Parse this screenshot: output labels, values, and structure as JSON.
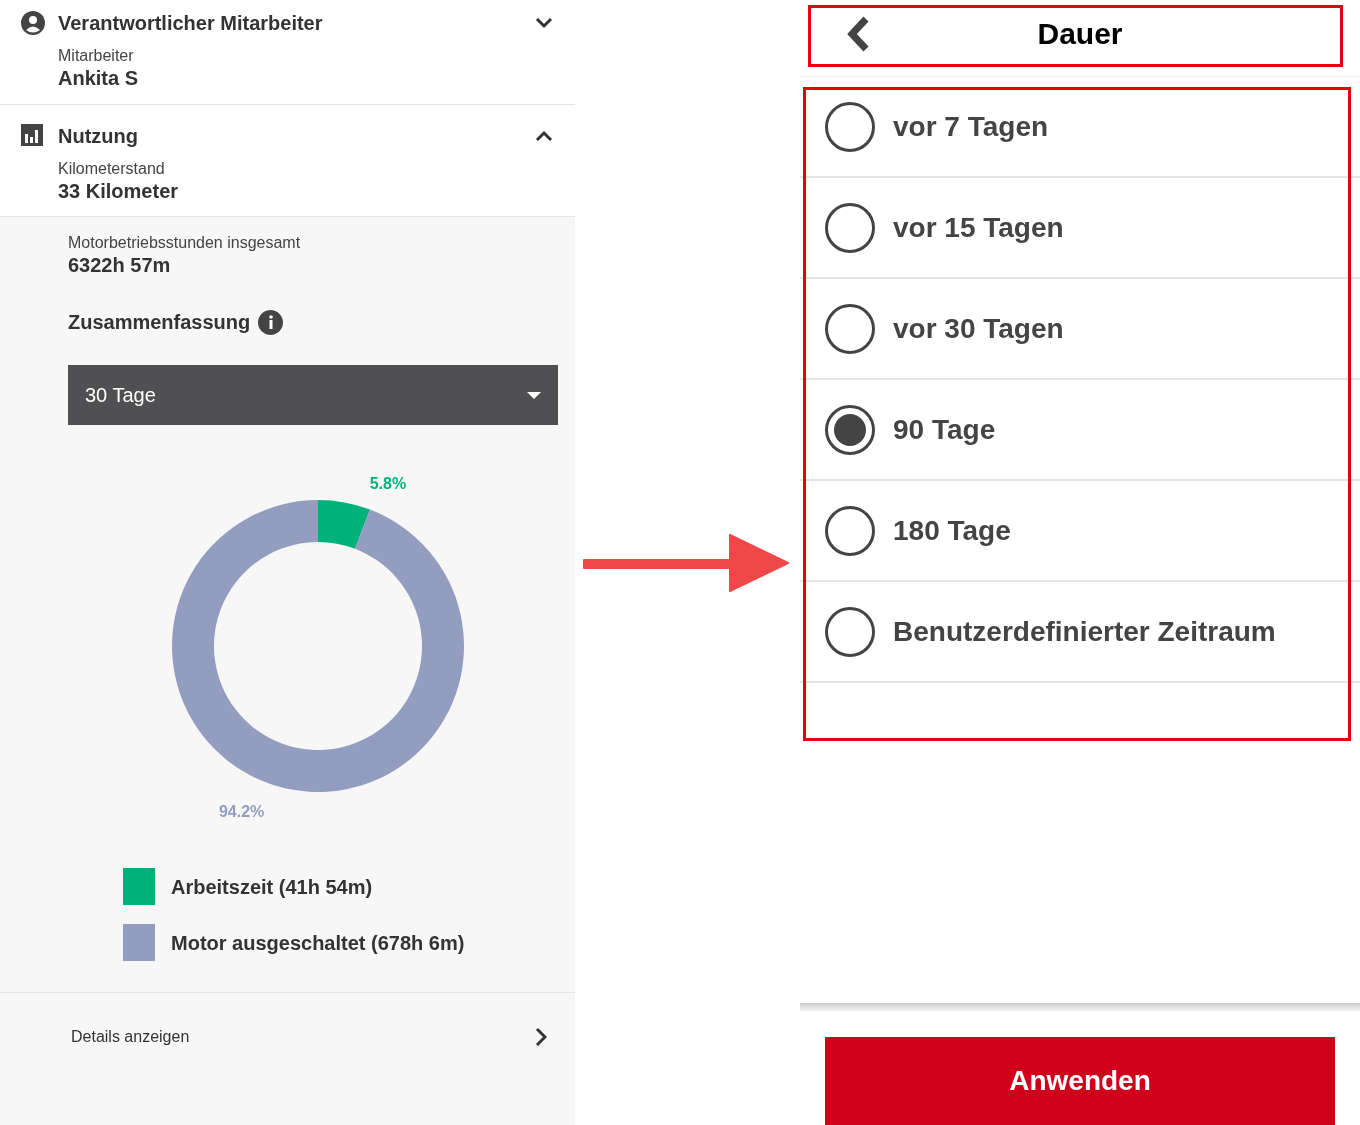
{
  "left_panel": {
    "sections": [
      {
        "kind": "person",
        "title": "Verantwortlicher Mitarbeiter",
        "expanded": false,
        "label": "Mitarbeiter",
        "value": "Ankita S"
      },
      {
        "kind": "usage",
        "title": "Nutzung",
        "expanded": true,
        "label": "Kilometerstand",
        "value": "33 Kilometer"
      }
    ],
    "engine_hours": {
      "label": "Motorbetriebsstunden insgesamt",
      "value": "6322h 57m"
    },
    "summary_title": "Zusammenfassung",
    "period_dropdown": {
      "value": "30 Tage"
    },
    "chart_data": {
      "type": "donut",
      "values": [
        5.8,
        94.2
      ],
      "value_labels": [
        "5.8%",
        "94.2%"
      ]
    },
    "legend": [
      {
        "label": "Arbeitszeit (41h 54m)",
        "color": "#00b27a"
      },
      {
        "label": "Motor ausgeschaltet (678h 6m)",
        "color": "#939dc0"
      }
    ],
    "details_link": "Details anzeigen"
  },
  "right_panel": {
    "title": "Dauer",
    "options": [
      {
        "label": "vor 7 Tagen",
        "selected": false
      },
      {
        "label": "vor 15 Tagen",
        "selected": false
      },
      {
        "label": "vor 30 Tagen",
        "selected": false
      },
      {
        "label": "90 Tage",
        "selected": true
      },
      {
        "label": "180 Tage",
        "selected": false
      },
      {
        "label": "Benutzerdefinierter Zeitraum",
        "selected": false
      }
    ],
    "apply_button": "Anwenden"
  }
}
